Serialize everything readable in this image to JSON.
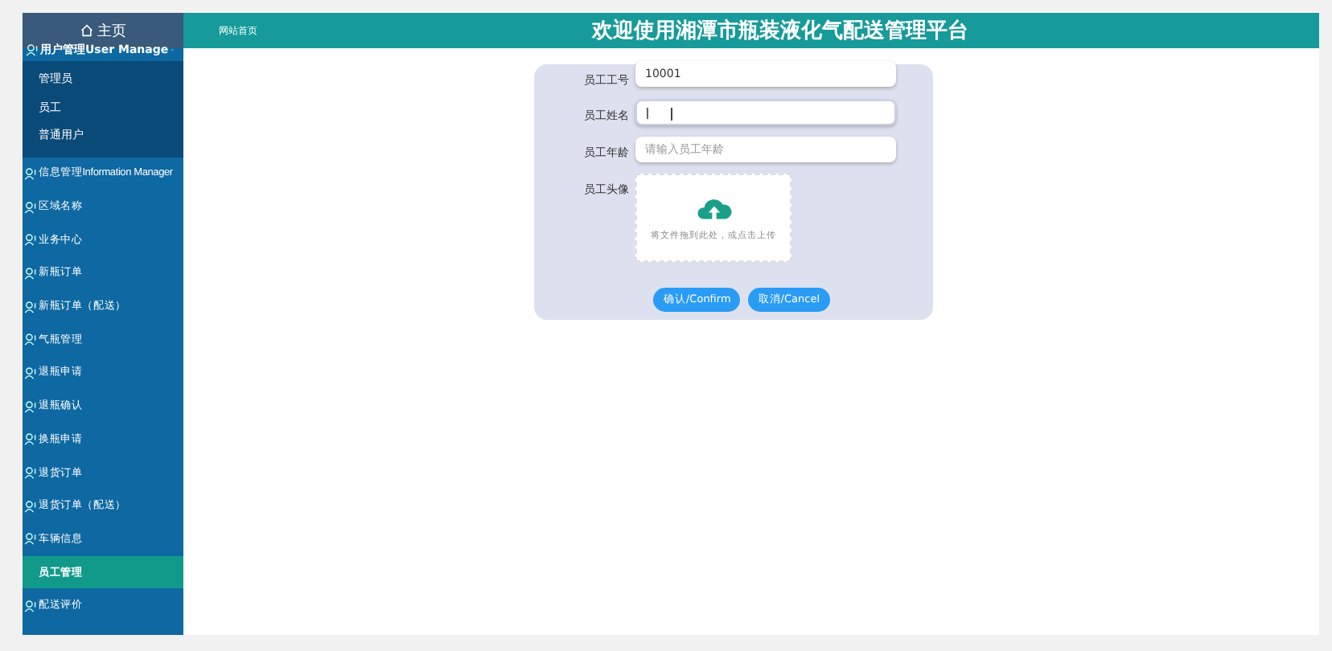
{
  "sidebar": {
    "home": "主页",
    "groups": [
      {
        "label": "用户管理User Manage",
        "expanded": true,
        "children": [
          {
            "label": "管理员",
            "selected": false
          },
          {
            "label": "员工",
            "selected": false
          },
          {
            "label": "普通用户",
            "selected": false
          }
        ]
      }
    ],
    "items": [
      {
        "label": "信息管理Information Manager",
        "selected": false
      },
      {
        "label": "区域名称",
        "selected": false
      },
      {
        "label": "业务中心",
        "selected": false
      },
      {
        "label": "新瓶订单",
        "selected": false
      },
      {
        "label": "新瓶订单（配送）",
        "selected": false
      },
      {
        "label": "气瓶管理",
        "selected": false
      },
      {
        "label": "退瓶申请",
        "selected": false
      },
      {
        "label": "退瓶确认",
        "selected": false
      },
      {
        "label": "换瓶申请",
        "selected": false
      },
      {
        "label": "退货订单",
        "selected": false
      },
      {
        "label": "退货订单（配送）",
        "selected": false
      },
      {
        "label": "车辆信息",
        "selected": false
      },
      {
        "label": "员工管理",
        "selected": true
      },
      {
        "label": "配送评价",
        "selected": false
      }
    ]
  },
  "header": {
    "link": "网站首页",
    "title": "欢迎使用湘潭市瓶装液化气配送管理平台"
  },
  "form": {
    "fields": [
      {
        "kind": "text",
        "label": "员工工号",
        "value": "10001",
        "focused": false
      },
      {
        "kind": "text",
        "label": "员工姓名",
        "focused": true
      },
      {
        "kind": "text",
        "label": "员工年龄",
        "placeholder": "请输入员工年龄",
        "focused": false
      },
      {
        "kind": "upload",
        "label": "员工头像",
        "hint": "将文件拖到此处，或点击上传"
      }
    ],
    "buttons": [
      "确认/Confirm",
      "取消/Cancel"
    ]
  }
}
